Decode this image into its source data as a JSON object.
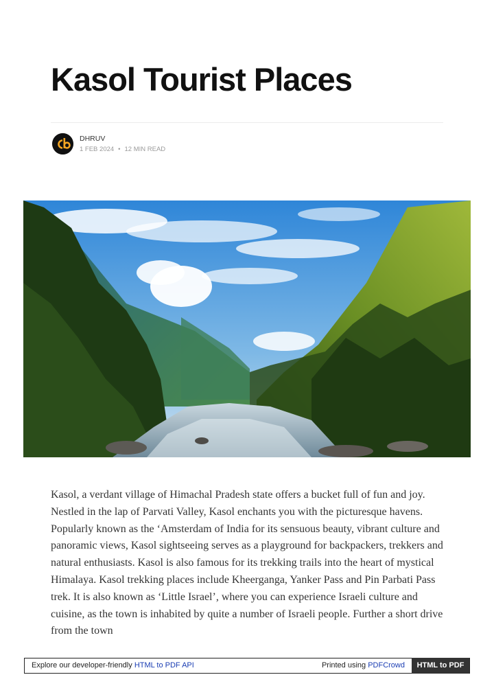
{
  "article": {
    "title": "Kasol Tourist Places",
    "author": "DHRUV",
    "date": "1 FEB 2024",
    "separator": "•",
    "read_time": "12 MIN READ",
    "avatar_icon": "cb-logo-icon",
    "hero_image": "kasol-valley-river-photo",
    "body": "Kasol, a verdant village of Himachal Pradesh state offers a bucket full of fun and joy. Nestled in the lap of Parvati Valley, Kasol enchants you with the picturesque havens. Popularly known as the ‘Amsterdam of India for its sensuous beauty, vibrant culture and panoramic views, Kasol sightseeing serves as a playground for backpackers, trekkers and natural enthusiasts. Kasol is also famous for its trekking trails into the heart of mystical Himalaya. Kasol trekking places include Kheerganga, Yanker Pass and Pin Parbati Pass trek. It is also known as ‘Little Israel’, where you can experience Israeli culture and cuisine, as the town is inhabited by quite a number of Israeli people. Further a short drive from the town"
  },
  "footer": {
    "explore_text": "Explore our developer-friendly ",
    "api_link": "HTML to PDF API",
    "printed_text": "Printed using ",
    "crowd_link": "PDFCrowd",
    "button_label": "HTML to PDF"
  },
  "colors": {
    "link": "#1a3db3",
    "avatar_orange": "#f5a623",
    "footer_button": "#333333"
  }
}
